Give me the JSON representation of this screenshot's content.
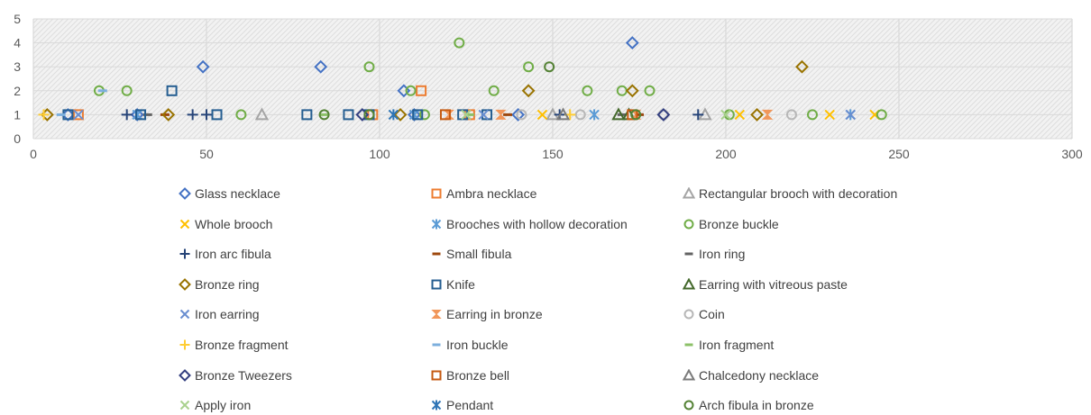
{
  "chart_data": {
    "type": "scatter",
    "title": "",
    "xlabel": "",
    "ylabel": "",
    "xlim": [
      0,
      300
    ],
    "ylim": [
      0,
      5
    ],
    "x_ticks": [
      "0",
      "50",
      "100",
      "150",
      "200",
      "250",
      "300"
    ],
    "y_ticks": [
      "0",
      "1",
      "2",
      "3",
      "4",
      "5"
    ],
    "grid": true,
    "legend_position": "bottom",
    "series": [
      {
        "name": "Glass necklace",
        "marker": "diamond",
        "color": "#4472C4",
        "points": [
          [
            49,
            3
          ],
          [
            83,
            3
          ],
          [
            107,
            2
          ],
          [
            173,
            4
          ],
          [
            10,
            1
          ],
          [
            30,
            1
          ],
          [
            110,
            1
          ],
          [
            140,
            1
          ]
        ]
      },
      {
        "name": "Ambra necklace",
        "marker": "square",
        "color": "#ED7D31",
        "points": [
          [
            126,
            1
          ],
          [
            112,
            2
          ],
          [
            13,
            1
          ],
          [
            98,
            1
          ]
        ]
      },
      {
        "name": "Rectangular brooch with decoration",
        "marker": "triangle",
        "color": "#A5A5A5",
        "points": [
          [
            66,
            1
          ],
          [
            150,
            1
          ],
          [
            194,
            1
          ]
        ]
      },
      {
        "name": "Whole brooch",
        "marker": "x",
        "color": "#FFC000",
        "points": [
          [
            204,
            1
          ],
          [
            230,
            1
          ],
          [
            243,
            1
          ],
          [
            147,
            1
          ]
        ]
      },
      {
        "name": "Brooches with hollow decoration",
        "marker": "asterisk",
        "color": "#5B9BD5",
        "points": [
          [
            162,
            1
          ],
          [
            236,
            1
          ],
          [
            30,
            1
          ],
          [
            110,
            1
          ]
        ]
      },
      {
        "name": "Bronze buckle",
        "marker": "circle",
        "color": "#70AD47",
        "points": [
          [
            19,
            2
          ],
          [
            27,
            2
          ],
          [
            97,
            3
          ],
          [
            123,
            4
          ],
          [
            133,
            2
          ],
          [
            143,
            3
          ],
          [
            109,
            2
          ],
          [
            160,
            2
          ],
          [
            170,
            2
          ],
          [
            178,
            2
          ],
          [
            60,
            1
          ],
          [
            113,
            1
          ],
          [
            201,
            1
          ],
          [
            225,
            1
          ],
          [
            245,
            1
          ]
        ]
      },
      {
        "name": "Iron arc fibula",
        "marker": "plus",
        "color": "#264478",
        "points": [
          [
            27,
            1
          ],
          [
            46,
            1
          ],
          [
            50,
            1
          ],
          [
            152,
            1
          ],
          [
            192,
            1
          ]
        ]
      },
      {
        "name": "Small fibula",
        "marker": "dash",
        "color": "#9E480E",
        "points": [
          [
            38,
            1
          ],
          [
            137,
            1
          ],
          [
            175,
            1
          ]
        ]
      },
      {
        "name": "Iron ring",
        "marker": "dash",
        "color": "#636363",
        "points": [
          [
            33,
            1
          ],
          [
            170,
            1
          ]
        ]
      },
      {
        "name": "Bronze ring",
        "marker": "diamond",
        "color": "#997300",
        "points": [
          [
            4,
            1
          ],
          [
            39,
            1
          ],
          [
            106,
            1
          ],
          [
            143,
            2
          ],
          [
            173,
            2
          ],
          [
            209,
            1
          ],
          [
            222,
            3
          ]
        ]
      },
      {
        "name": "Knife",
        "marker": "square",
        "color": "#255E91",
        "points": [
          [
            10,
            1
          ],
          [
            31,
            1
          ],
          [
            40,
            2
          ],
          [
            53,
            1
          ],
          [
            79,
            1
          ],
          [
            91,
            1
          ],
          [
            97,
            1
          ],
          [
            111,
            1
          ],
          [
            124,
            1
          ],
          [
            131,
            1
          ]
        ]
      },
      {
        "name": "Earring with vitreous paste",
        "marker": "triangle",
        "color": "#43682B",
        "points": [
          [
            169,
            1
          ],
          [
            172,
            1
          ]
        ]
      },
      {
        "name": "Iron earring",
        "marker": "x",
        "color": "#698ED0",
        "points": [
          [
            130,
            1
          ],
          [
            236,
            1
          ],
          [
            13,
            1
          ]
        ]
      },
      {
        "name": "Earring in bronze",
        "marker": "hourglass",
        "color": "#F1975A",
        "points": [
          [
            120,
            1
          ],
          [
            135,
            1
          ],
          [
            212,
            1
          ],
          [
            174,
            1
          ]
        ]
      },
      {
        "name": "Coin",
        "marker": "circle",
        "color": "#B7B7B7",
        "points": [
          [
            141,
            1
          ],
          [
            158,
            1
          ],
          [
            219,
            1
          ],
          [
            182,
            1
          ]
        ]
      },
      {
        "name": "Bronze fragment",
        "marker": "plus",
        "color": "#FFCD33",
        "points": [
          [
            3,
            1
          ],
          [
            155,
            1
          ]
        ]
      },
      {
        "name": "Iron buckle",
        "marker": "dash",
        "color": "#7CAFDD",
        "points": [
          [
            20,
            2
          ],
          [
            8,
            1
          ]
        ]
      },
      {
        "name": "Iron fragment",
        "marker": "dash",
        "color": "#8CC168",
        "points": [
          [
            84,
            1
          ],
          [
            126,
            1
          ]
        ]
      },
      {
        "name": "Bronze Tweezers",
        "marker": "diamond",
        "color": "#333F80",
        "points": [
          [
            95,
            1
          ],
          [
            182,
            1
          ]
        ]
      },
      {
        "name": "Bronze bell",
        "marker": "square",
        "color": "#C55A11",
        "points": [
          [
            173,
            1
          ],
          [
            119,
            1
          ]
        ]
      },
      {
        "name": "Chalcedony necklace",
        "marker": "triangle",
        "color": "#7B7B7B",
        "points": [
          [
            153,
            1
          ]
        ]
      },
      {
        "name": "Apply iron",
        "marker": "x",
        "color": "#A9D18E",
        "points": [
          [
            200,
            1
          ],
          [
            125,
            1
          ]
        ]
      },
      {
        "name": "Pendant",
        "marker": "asterisk",
        "color": "#2E75B6",
        "points": [
          [
            104,
            1
          ]
        ]
      },
      {
        "name": "Arch fibula in bronze",
        "marker": "circle",
        "color": "#548235",
        "points": [
          [
            84,
            1
          ],
          [
            149,
            3
          ],
          [
            174,
            1
          ],
          [
            97,
            1
          ]
        ]
      }
    ]
  }
}
